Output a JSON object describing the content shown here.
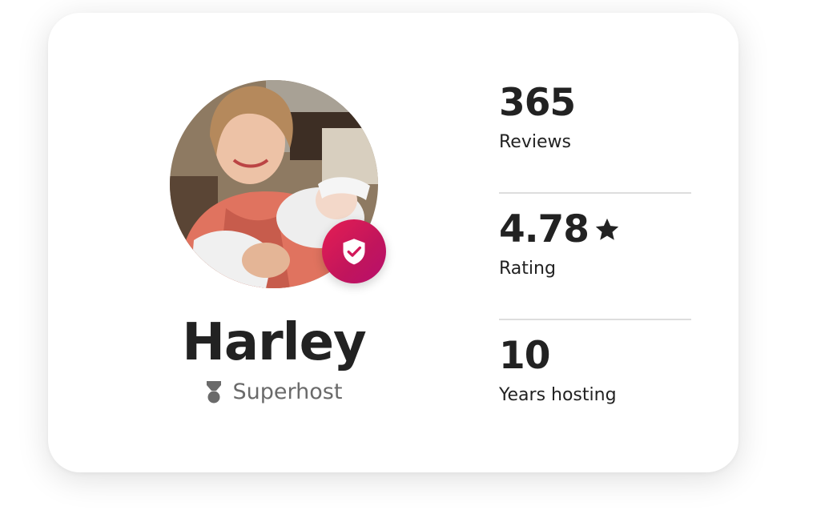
{
  "host": {
    "name": "Harley",
    "badge_label": "Superhost"
  },
  "stats": [
    {
      "value": "365",
      "label": "Reviews"
    },
    {
      "value": "4.78",
      "label": "Rating"
    },
    {
      "value": "10",
      "label": "Years hosting"
    }
  ],
  "icons": {
    "verified": "shield-check-icon",
    "superhost": "superhost-medal-icon",
    "rating": "star-icon"
  },
  "colors": {
    "text": "#222222",
    "muted": "#6a6a6a",
    "badge_start": "#e51e53",
    "badge_end": "#b70f6d",
    "divider": "#dddddd"
  }
}
